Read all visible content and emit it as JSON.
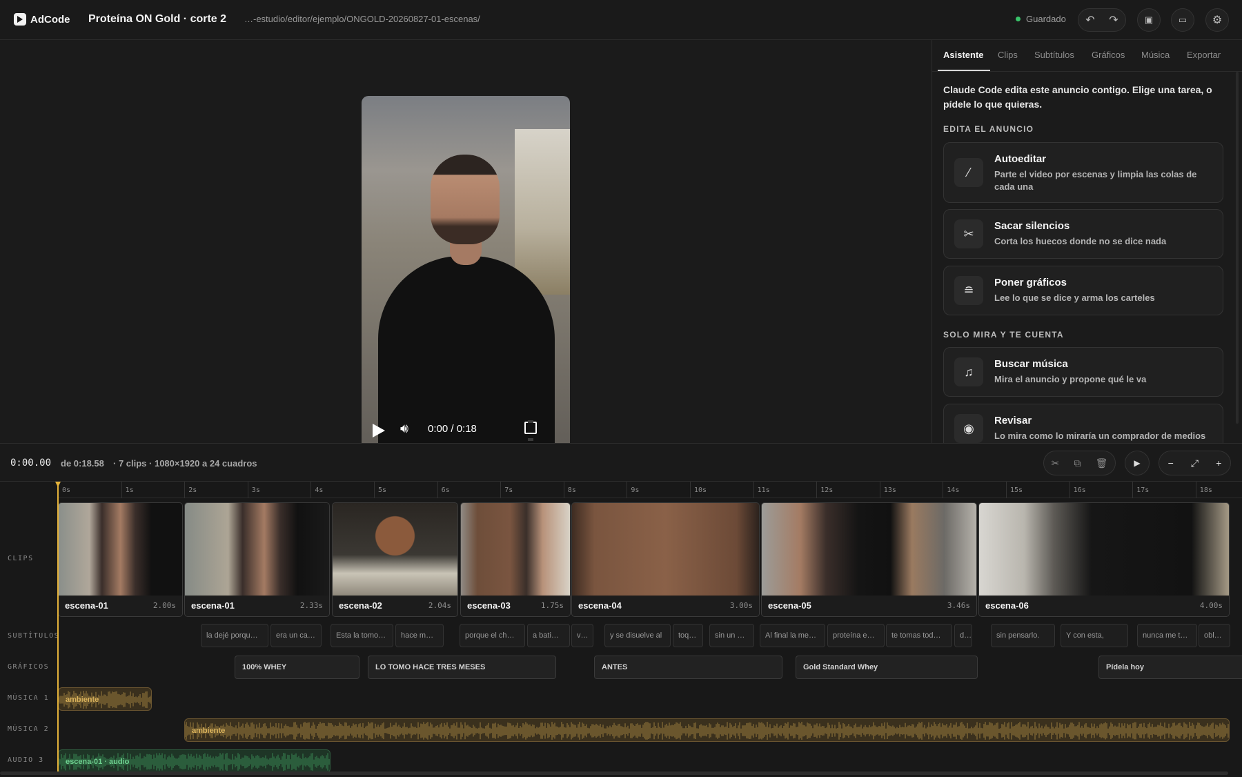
{
  "app": {
    "name": "AdCode",
    "logo_icon": "play-logo-icon"
  },
  "header": {
    "project_title": "Proteína ON Gold · corte 2",
    "path": "…-estudio/editor/ejemplo/ONGOLD-20260827-01-escenas/",
    "save_status": "Guardado",
    "status_color": "#39c46a",
    "buttons": [
      "undo-icon",
      "redo-icon",
      "save-icon",
      "folder-icon",
      "gear-icon"
    ]
  },
  "player": {
    "time": "0:00 / 0:18",
    "progress": 0,
    "controls": [
      "play-icon",
      "volume-icon",
      "fullscreen-icon"
    ]
  },
  "panel": {
    "tabs": [
      "Asistente",
      "Clips",
      "Subtítulos",
      "Gráficos",
      "Música",
      "Exportar"
    ],
    "active_tab": "Asistente",
    "intro": "Claude Code edita este anuncio contigo. Elige una tarea, o pídele lo que quieras.",
    "section_edit": "EDITA EL ANUNCIO",
    "section_watch": "SOLO MIRA Y TE CUENTA",
    "cards": [
      {
        "title": "Autoeditar",
        "desc": "Parte el video por escenas y limpia las colas de cada una",
        "icon": "magic-wand-icon"
      },
      {
        "title": "Sacar silencios",
        "desc": "Corta los huecos donde no se dice nada",
        "icon": "scissors-icon"
      },
      {
        "title": "Poner gráficos",
        "desc": "Lee lo que se dice y arma los carteles",
        "icon": "layers-icon"
      },
      {
        "title": "Buscar música",
        "desc": "Mira el anuncio y propone qué le va",
        "icon": "music-note-icon"
      },
      {
        "title": "Revisar",
        "desc": "Lo mira como lo miraría un comprador de medios",
        "icon": "eye-icon"
      }
    ]
  },
  "timeline": {
    "current": "0:00.00",
    "duration": "de 0:18.58",
    "meta": "· 7 clips · 1080×1920 a 24 cuadros",
    "ruler": [
      "0s",
      "1s",
      "2s",
      "3s",
      "4s",
      "5s",
      "6s",
      "7s",
      "8s",
      "9s",
      "10s",
      "11s",
      "12s",
      "13s",
      "14s",
      "15s",
      "16s",
      "17s",
      "18s"
    ],
    "track_labels": {
      "clips": "CLIPS",
      "subs": "SUBTÍTULOS",
      "gfx": "GRÁFICOS",
      "music1": "MÚSICA 1",
      "music2": "MÚSICA 2",
      "audio3": "AUDIO 3"
    },
    "clips": [
      {
        "name": "escena-01",
        "dur": "2.00s"
      },
      {
        "name": "escena-01",
        "dur": "2.33s"
      },
      {
        "name": "escena-02",
        "dur": "2.04s"
      },
      {
        "name": "escena-03",
        "dur": "1.75s"
      },
      {
        "name": "escena-04",
        "dur": "3.00s"
      },
      {
        "name": "escena-05",
        "dur": "3.46s"
      },
      {
        "name": "escena-06",
        "dur": "4.00s"
      }
    ],
    "subtitles": [
      "la dejé porqu…",
      "era un ca…",
      "Esta la tomo…",
      "hace m…",
      "porque el ch…",
      "a bati…",
      "v…",
      "y se disuelve al",
      "toq…",
      "sin un g…",
      "Al final la me…",
      "proteína e…",
      "te tomas tod…",
      "d…",
      "sin pensarlo.",
      "Y con esta,",
      "nunca me t…",
      "obl…"
    ],
    "graphics": [
      "100% WHEY",
      "LO TOMO HACE TRES MESES",
      "ANTES",
      "Gold Standard Whey",
      "Pídela hoy"
    ],
    "music1": {
      "label": "ambiente",
      "color": "#b49146"
    },
    "music2": {
      "label": "ambiente",
      "color": "#b49146"
    },
    "audio3": {
      "label": "escena-01 · audio",
      "color": "#3f9a5f"
    },
    "playhead_color": "#e4b23a",
    "tool_icons": [
      "scissors-icon",
      "copy-icon",
      "trash-icon",
      "play-icon",
      "zoom-out-icon",
      "fit-icon",
      "zoom-in-icon"
    ]
  }
}
